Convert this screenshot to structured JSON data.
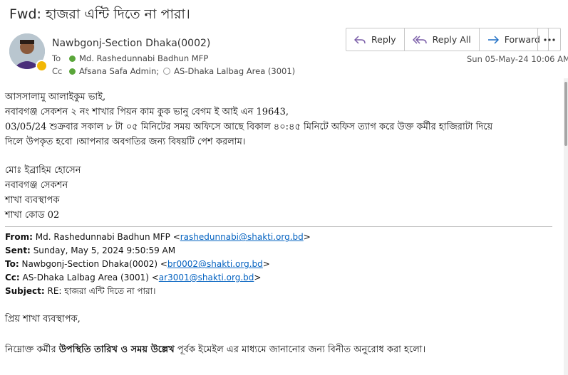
{
  "email": {
    "subject": "Fwd: হাজরা এন্টি দিতে না পারা।",
    "sender": "Nawbgonj-Section Dhaka(0002)",
    "to_label": "To",
    "to_value": "Md. Rashedunnabi Badhun MFP",
    "cc_label": "Cc",
    "cc_value1": "Afsana Safa Admin;",
    "cc_value2": "AS-Dhaka  Lalbag Area (3001)",
    "date": "Sun 05-May-24 10:06 AM"
  },
  "actions": {
    "reply": "Reply",
    "reply_all": "Reply All",
    "forward": "Forward"
  },
  "body": {
    "greeting": "আসসালামু আলাইকুম ভাই,",
    "line1": "নবাবগঞ্জ সেকশন ২ নং শাখার পিয়ন কাম কুক ভানু বেগম ই আই এন 19643,",
    "line2": "03/05/24 শুক্রবার সকাল ৮ টা ০৫ মিনিটের সময় অফিসে আছে বিকাল ৪০:৪৫ মিনিটে অফিস ত্যাগ করে উক্ত কর্মীর হাজিরাটা দিয়ে",
    "line3": "দিলে উপকৃত হবো ।আপনার অবগতির জন্য বিষয়টি পেশ করলাম।",
    "sig1": "মোঃ ইব্রাহিম হোসেন",
    "sig2": "নবাবগঞ্জ সেকশন",
    "sig3": "শাখা ব্যবস্থাপক",
    "sig4": "শাখা কোড 02"
  },
  "forwarded": {
    "from_label": "From:",
    "from_name": "Md. Rashedunnabi Badhun MFP <",
    "from_email": "rashedunnabi@shakti.org.bd",
    "from_end": ">",
    "sent_label": "Sent:",
    "sent_value": "Sunday, May 5, 2024 9:50:59 AM",
    "to_label": "To:",
    "to_name": "Nawbgonj-Section Dhaka(0002) <",
    "to_email": "br0002@shakti.org.bd",
    "to_end": ">",
    "cc_label": "Cc:",
    "cc_name": "AS-Dhaka Lalbag Area (3001) <",
    "cc_email": "ar3001@shakti.org.bd",
    "cc_end": ">",
    "subject_label": "Subject:",
    "subject_value": "RE: হাজরা এন্টি দিতে না পারা।",
    "salutation": "প্রিয় শাখা ব্যবস্থাপক,",
    "msg_pre": "নিম্নোক্ত কর্মীর",
    "msg_bold": "উপস্থিতি তারিখ ও সময় উল্লেখ",
    "msg_post": "পূর্বক ইমেইল এর মাধ্যমে জানানোর জন্য বিনীত অনুরোধ করা হলো।"
  },
  "colors": {
    "link": "#0563c1",
    "presence": "#f2b705",
    "online": "#5aa63a",
    "accent_icon": "#7a5da8",
    "forward_icon": "#1f6fc5"
  }
}
